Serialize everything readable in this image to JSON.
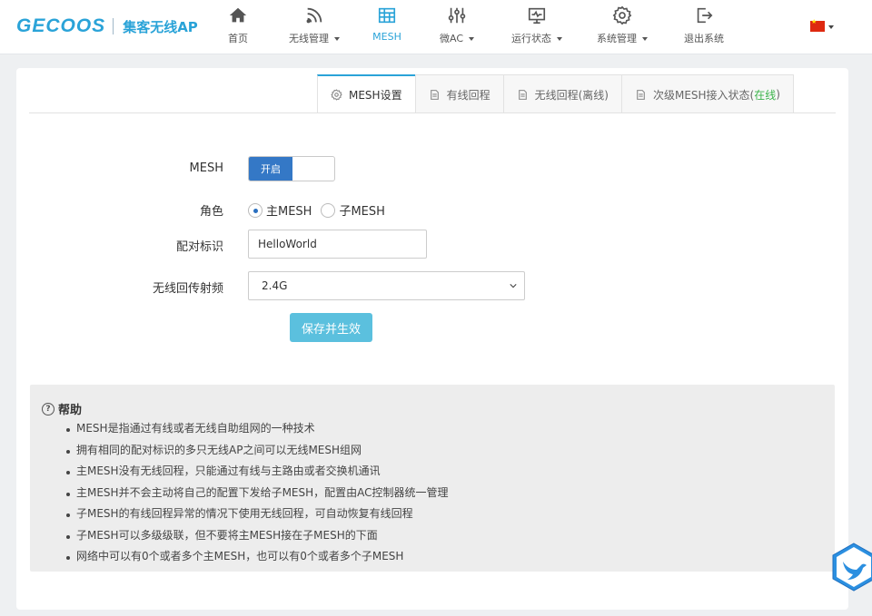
{
  "brand": {
    "name": "GECOOS",
    "subtitle": "集客无线AP"
  },
  "nav": {
    "items": [
      {
        "label": "首页",
        "icon": "home-icon",
        "dropdown": false
      },
      {
        "label": "无线管理",
        "icon": "wifi-icon",
        "dropdown": true
      },
      {
        "label": "MESH",
        "icon": "mesh-icon",
        "dropdown": false,
        "active": true
      },
      {
        "label": "微AC",
        "icon": "sliders-icon",
        "dropdown": true
      },
      {
        "label": "运行状态",
        "icon": "monitor-icon",
        "dropdown": true
      },
      {
        "label": "系统管理",
        "icon": "gear-icon",
        "dropdown": true
      },
      {
        "label": "退出系统",
        "icon": "logout-icon",
        "dropdown": false
      }
    ],
    "language": "china-flag-icon"
  },
  "tabs": {
    "items": [
      {
        "label": "MESH设置",
        "icon": "gear-icon",
        "active": true
      },
      {
        "label": "有线回程",
        "icon": "document-icon"
      },
      {
        "label": "无线回程(离线)",
        "icon": "document-icon"
      },
      {
        "label": "次级MESH接入状态(",
        "status": "在线",
        "suffix": ")",
        "icon": "document-icon"
      }
    ]
  },
  "form": {
    "mesh_label": "MESH",
    "mesh_switch_on_label": "开启",
    "role_label": "角色",
    "role_options": [
      {
        "label": "主MESH",
        "checked": true
      },
      {
        "label": "子MESH",
        "checked": false
      }
    ],
    "pair_id_label": "配对标识",
    "pair_id_value": "HelloWorld",
    "backhaul_band_label": "无线回传射频",
    "backhaul_band_value": "2.4G",
    "save_button_label": "保存并生效"
  },
  "help": {
    "title": "帮助",
    "items": [
      "MESH是指通过有线或者无线自助组网的一种技术",
      "拥有相同的配对标识的多只无线AP之间可以无线MESH组网",
      "主MESH没有无线回程，只能通过有线与主路由或者交换机通讯",
      "主MESH并不会主动将自己的配置下发给子MESH，配置由AC控制器统一管理",
      "子MESH的有线回程异常的情况下使用无线回程，可自动恢复有线回程",
      "子MESH可以多级级联，但不要将主MESH接在子MESH的下面",
      "网络中可以有0个或者多个主MESH，也可以有0个或者多个子MESH"
    ]
  },
  "colors": {
    "accent": "#2aa3d8",
    "switch_on": "#3478c6",
    "save_button": "#5bc0de",
    "online_status": "#3bb34a",
    "help_background": "#ededed"
  }
}
